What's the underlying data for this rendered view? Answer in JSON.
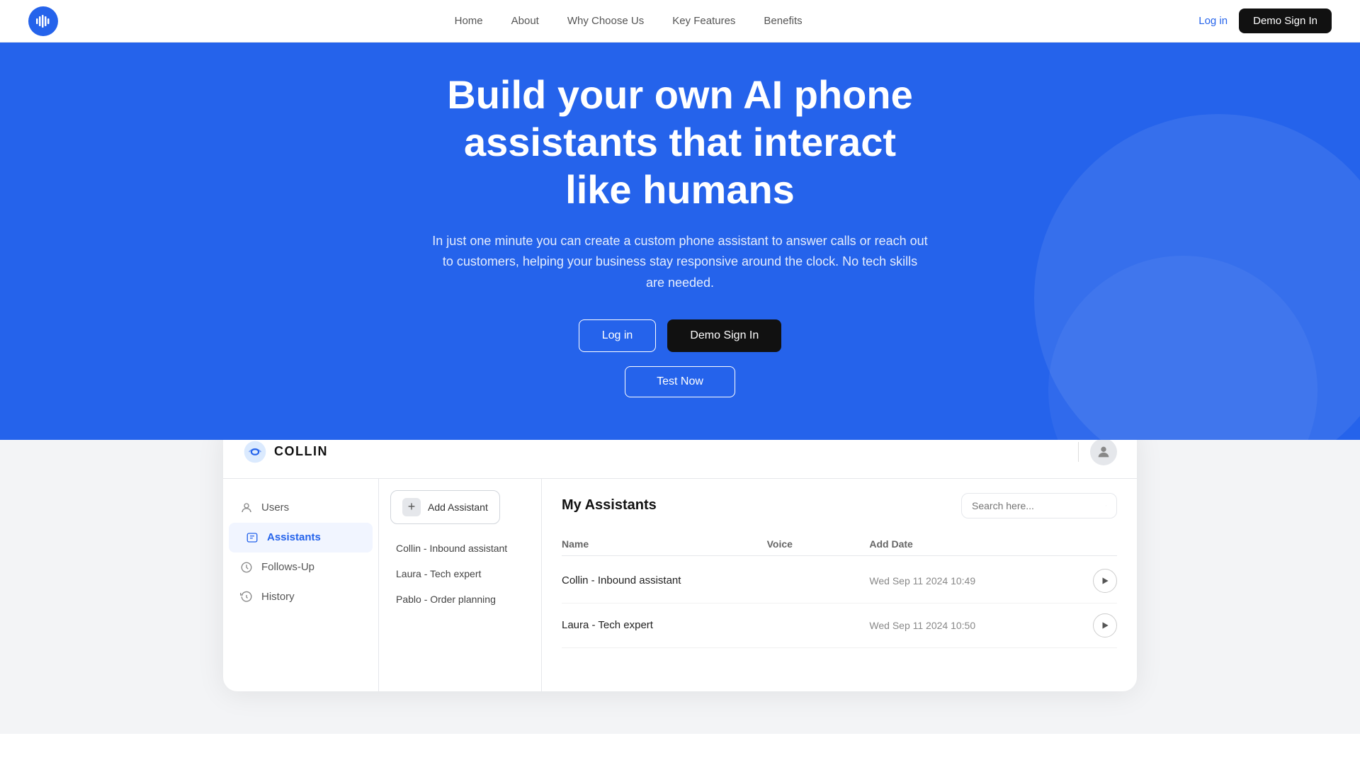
{
  "navbar": {
    "links": [
      "Home",
      "About",
      "Why Choose Us",
      "Key Features",
      "Benefits"
    ],
    "login_label": "Log in",
    "demo_label": "Demo Sign In"
  },
  "hero": {
    "headline_line1": "Build your own AI phone assistants that interact",
    "headline_line2": "like humans",
    "subtext": "In just one minute you can create a custom phone assistant to answer calls or reach out to customers, helping your business stay responsive around the clock. No tech skills are needed.",
    "btn_login": "Log in",
    "btn_demo": "Demo Sign In",
    "btn_test": "Test Now"
  },
  "dashboard": {
    "logo_text": "COLLIN",
    "sidebar": {
      "items": [
        {
          "label": "Users",
          "icon": "user-icon"
        },
        {
          "label": "Assistants",
          "icon": "assistants-icon",
          "active": true
        },
        {
          "label": "Follows-Up",
          "icon": "followup-icon"
        },
        {
          "label": "History",
          "icon": "history-icon"
        }
      ]
    },
    "assistant_list": {
      "add_label": "Add Assistant",
      "items": [
        {
          "name": "Collin - Inbound assistant"
        },
        {
          "name": "Laura - Tech expert"
        },
        {
          "name": "Pablo - Order planning"
        }
      ]
    },
    "my_assistants": {
      "title": "My Assistants",
      "search_placeholder": "Search here...",
      "columns": [
        "Name",
        "Voice",
        "Add Date"
      ],
      "rows": [
        {
          "name": "Collin - Inbound assistant",
          "voice": "",
          "date": "Wed Sep 11 2024  10:49"
        },
        {
          "name": "Laura - Tech expert",
          "voice": "",
          "date": "Wed Sep 11 2024  10:50"
        }
      ]
    }
  }
}
